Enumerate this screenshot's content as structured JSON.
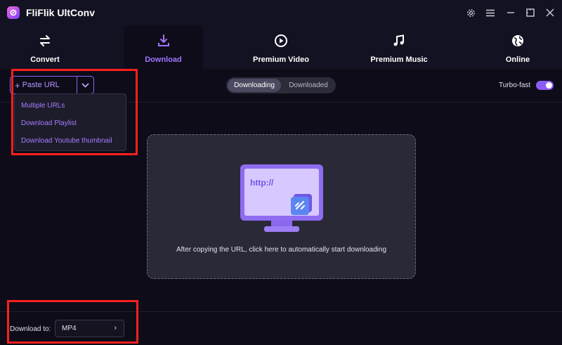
{
  "app": {
    "title": "FliFlik UltConv"
  },
  "nav": {
    "tabs": [
      {
        "label": "Convert",
        "icon": "convert-arrows-icon"
      },
      {
        "label": "Download",
        "icon": "download-icon",
        "active": true
      },
      {
        "label": "Premium Video",
        "icon": "play-circle-icon"
      },
      {
        "label": "Premium Music",
        "icon": "music-note-icon"
      },
      {
        "label": "Online",
        "icon": "globe-icon"
      }
    ]
  },
  "toolbar": {
    "paste_url": "Paste URL",
    "dropdown": [
      "Multiple URLs",
      "Download Playlist",
      "Download Youtube thumbnail"
    ],
    "segments": [
      "Downloading",
      "Downloaded"
    ],
    "turbo_label": "Turbo-fast",
    "turbo_on": true
  },
  "dropzone": {
    "url_text": "http://",
    "hint": "After copying the URL, click here to automatically start downloading"
  },
  "footer": {
    "download_to_label": "Download to:",
    "format": "MP4"
  },
  "colors": {
    "accent": "#8d5cf6",
    "highlight": "#ff1f1f",
    "background": "#0d0c18"
  }
}
